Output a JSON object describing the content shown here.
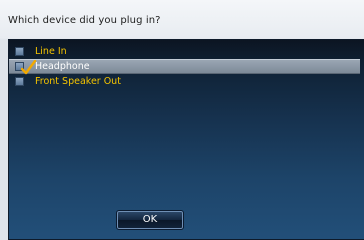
{
  "dialog": {
    "title": "Which device did you plug in?"
  },
  "devices": [
    {
      "label": "Line In",
      "checked": false,
      "selected": false
    },
    {
      "label": "Headphone",
      "checked": true,
      "selected": true
    },
    {
      "label": "Front Speaker Out",
      "checked": false,
      "selected": false
    }
  ],
  "buttons": {
    "ok_label": "OK"
  },
  "colors": {
    "item_text": "#f5c400",
    "selected_text": "#ffffff",
    "checkmark": "#f2a900"
  },
  "icons": {
    "check": "check-icon"
  }
}
